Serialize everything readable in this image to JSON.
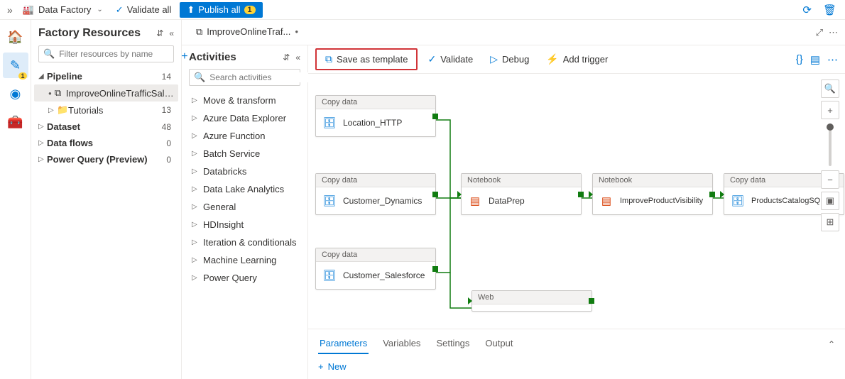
{
  "topbar": {
    "breadcrumb_label": "Data Factory",
    "validate_all": "Validate all",
    "publish_all": "Publish all",
    "publish_badge": "1"
  },
  "rail": {
    "pencil_badge": "1"
  },
  "resources": {
    "title": "Factory Resources",
    "filter_placeholder": "Filter resources by name",
    "tree": [
      {
        "label": "Pipeline",
        "count": "14",
        "bold": true,
        "expanded": true
      },
      {
        "label": "ImproveOnlineTrafficSales",
        "indent": 1,
        "selected": true,
        "dot": true,
        "pipe_icon": true
      },
      {
        "label": "Tutorials",
        "count": "13",
        "indent": 1,
        "folder": true
      },
      {
        "label": "Dataset",
        "count": "48",
        "bold": true
      },
      {
        "label": "Data flows",
        "count": "0",
        "bold": true
      },
      {
        "label": "Power Query (Preview)",
        "count": "0",
        "bold": true
      }
    ]
  },
  "tab": {
    "label": "ImproveOnlineTraf..."
  },
  "activities": {
    "title": "Activities",
    "search_placeholder": "Search activities",
    "items": [
      "Move & transform",
      "Azure Data Explorer",
      "Azure Function",
      "Batch Service",
      "Databricks",
      "Data Lake Analytics",
      "General",
      "HDInsight",
      "Iteration & conditionals",
      "Machine Learning",
      "Power Query"
    ]
  },
  "toolbar": {
    "save_template": "Save as template",
    "validate": "Validate",
    "debug": "Debug",
    "add_trigger": "Add trigger"
  },
  "nodes": {
    "copy_label": "Copy data",
    "notebook_label": "Notebook",
    "web_label": "Web",
    "n1": "Location_HTTP",
    "n2": "Customer_Dynamics",
    "n3": "Customer_Salesforce",
    "n4": "DataPrep",
    "n5": "ImproveProductVisibility",
    "n6": "ProductsCatalogSQLD"
  },
  "bottom": {
    "tabs": [
      "Parameters",
      "Variables",
      "Settings",
      "Output"
    ],
    "new": "New"
  }
}
